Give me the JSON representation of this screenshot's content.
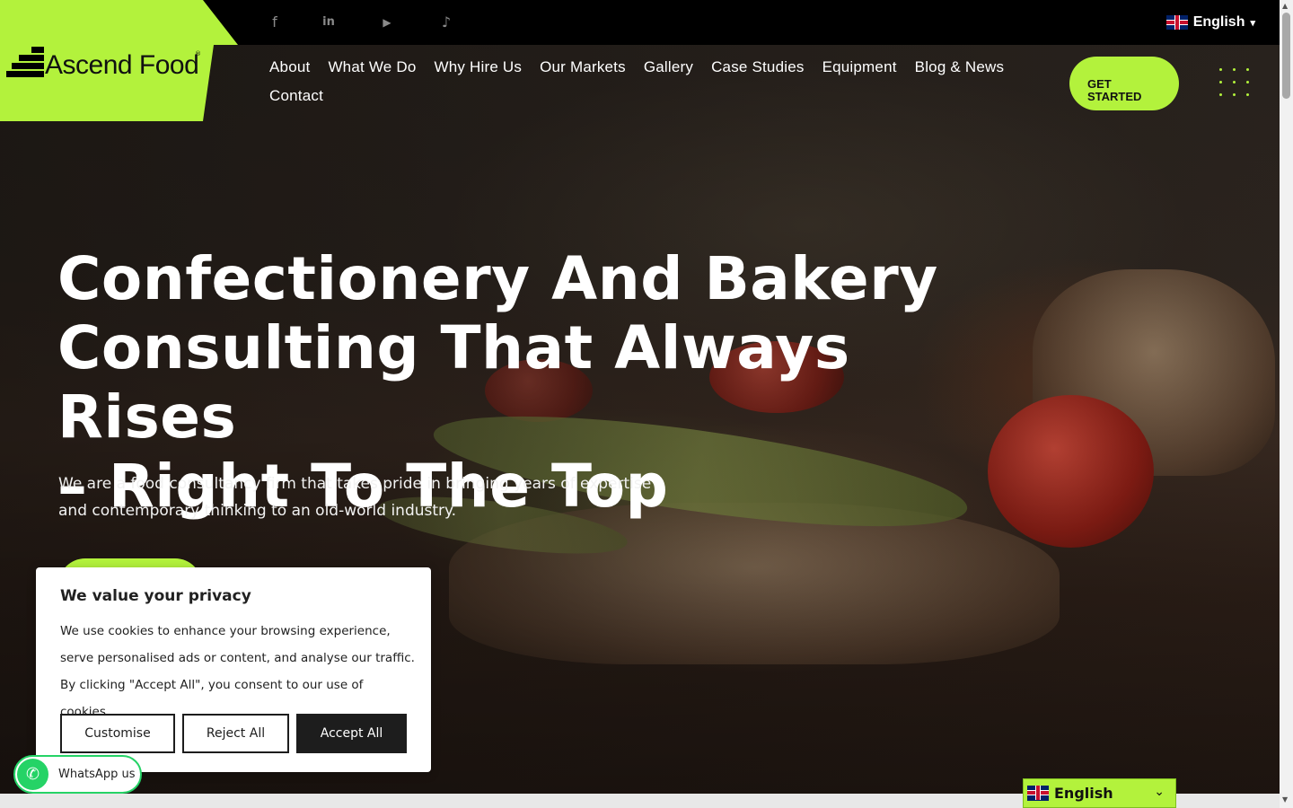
{
  "topbar": {
    "social": [
      {
        "icon": "facebook-icon",
        "glyph": "f"
      },
      {
        "icon": "linkedin-icon",
        "glyph": "in"
      },
      {
        "icon": "youtube-icon",
        "glyph": "▶"
      },
      {
        "icon": "tiktok-icon",
        "glyph": "♪"
      }
    ],
    "language": "English",
    "language_caret": "▾"
  },
  "logo": {
    "text": "Ascend Food",
    "reg": "®"
  },
  "nav": {
    "items": [
      "About",
      "What We Do",
      "Why Hire Us",
      "Our Markets",
      "Gallery",
      "Case Studies",
      "Equipment",
      "Blog & News",
      "Contact"
    ],
    "cta_line1": "GET",
    "cta_line2": "STARTED"
  },
  "hero": {
    "line1": "Confectionery And Bakery",
    "line2": "Consulting That Always Rises",
    "line3": "– Right To The Top",
    "sub1": "We are a food consultancy firm that takes pride in bringing years of expertise",
    "sub2": "and contemporary thinking to an old-world industry."
  },
  "cookie": {
    "title": "We value your privacy",
    "line1": "We use cookies to enhance your browsing experience,",
    "line2": "serve personalised ads or content, and analyse our traffic.",
    "line3": "By clicking \"Accept All\", you consent to our use of cookies.",
    "customise": "Customise",
    "reject": "Reject All",
    "accept": "Accept All"
  },
  "whatsapp": {
    "label": "WhatsApp us",
    "icon": "whatsapp-icon"
  },
  "language_widget": {
    "label": "English",
    "chevron": "⌄"
  },
  "colors": {
    "accent": "#b3f23c",
    "topbar": "#000000",
    "whatsapp": "#25d366"
  }
}
